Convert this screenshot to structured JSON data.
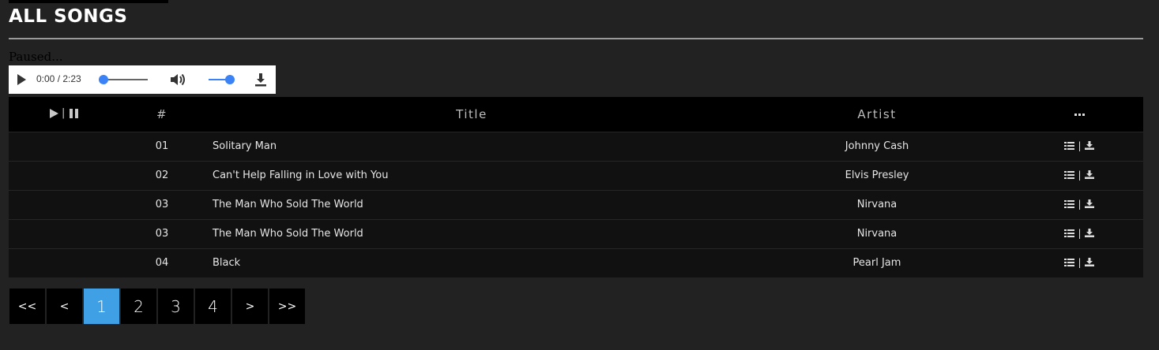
{
  "page": {
    "title": "ALL SONGS",
    "status": "Paused..."
  },
  "player": {
    "time": "0:00 / 2:23",
    "progress": 0,
    "volume": 1.0
  },
  "table": {
    "headers": {
      "number": "#",
      "title": "Title",
      "artist": "Artist"
    },
    "rows": [
      {
        "number": "01",
        "title": "Solitary Man",
        "artist": "Johnny Cash"
      },
      {
        "number": "02",
        "title": "Can't Help Falling in Love with You",
        "artist": "Elvis Presley"
      },
      {
        "number": "03",
        "title": "The Man Who Sold The World",
        "artist": "Nirvana"
      },
      {
        "number": "03",
        "title": "The Man Who Sold The World",
        "artist": "Nirvana"
      },
      {
        "number": "04",
        "title": "Black",
        "artist": "Pearl Jam"
      }
    ],
    "action_separator": "|"
  },
  "pagination": {
    "first": "<<",
    "prev": "<",
    "pages": [
      "1",
      "2",
      "3",
      "4"
    ],
    "active_page": "1",
    "next": ">",
    "last": ">>"
  },
  "colors": {
    "background": "#222222",
    "accent": "#3fa0e6",
    "slider": "#3b82f6"
  }
}
